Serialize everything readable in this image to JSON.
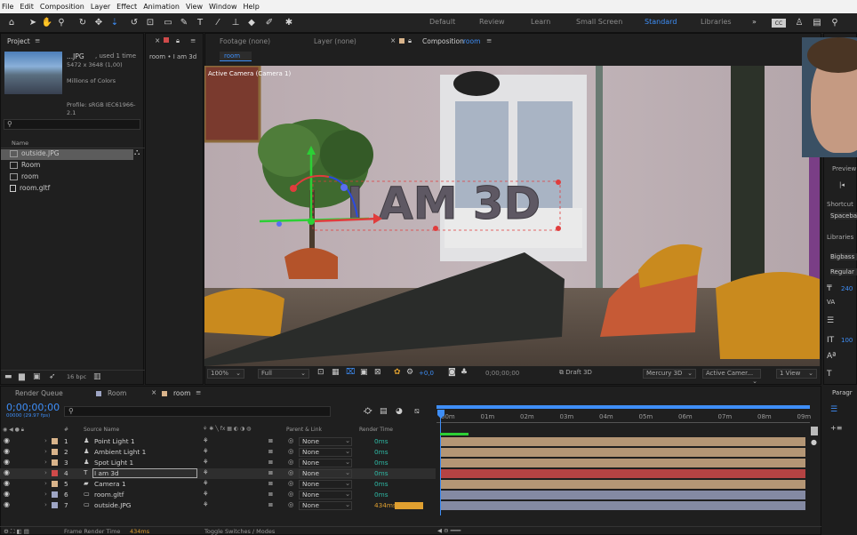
{
  "menu": [
    "File",
    "Edit",
    "Composition",
    "Layer",
    "Effect",
    "Animation",
    "View",
    "Window",
    "Help"
  ],
  "workspaces": {
    "items": [
      "Default",
      "Review",
      "Learn",
      "Small Screen",
      "Standard",
      "Libraries"
    ],
    "active": "Standard",
    "more": "»"
  },
  "project": {
    "title": "Project",
    "thumb_name": "...JPG",
    "thumb_used": ", used 1 time",
    "thumb_dims": "5472 x 3648 (1,00)",
    "thumb_colors": "Millions of Colors",
    "thumb_profile": "Profile: sRGB IEC61966-2.1",
    "search_placeholder": "",
    "col_name": "Name",
    "items": [
      "outside.JPG",
      "Room",
      "room",
      "room.gltf"
    ],
    "bpc": "16 bpc"
  },
  "layer_panel": {
    "tab": "room • I am 3d"
  },
  "viewer_tabs": {
    "footage": "Footage (none)",
    "layer": "Layer (none)",
    "composition": "Composition",
    "comp_name": "room",
    "sub_tab": "room"
  },
  "viewer": {
    "camera_label": "Active Camera (Camera 1)",
    "text_3d": "I AM 3D",
    "zoom": "100%",
    "quality": "Full",
    "exposure": "+0,0",
    "timecode": "0;00;00;00",
    "draft": "Draft 3D",
    "renderer": "Mercury 3D",
    "camera": "Active Camer...",
    "view": "1 View"
  },
  "timeline": {
    "tabs": [
      "Render Queue",
      "Room",
      "room"
    ],
    "active_tab": "room",
    "timecode": "0;00;00;00",
    "timecode_sub": "00000 (29.97 fps)",
    "col_hash": "#",
    "col_source": "Source Name",
    "col_parent": "Parent & Link",
    "col_render": "Render Time",
    "ruler": [
      "00m",
      "01m",
      "02m",
      "03m",
      "04m",
      "05m",
      "06m",
      "07m",
      "08m",
      "09m"
    ],
    "layers": [
      {
        "num": "1",
        "name": "Point Light 1",
        "parent": "None",
        "render": "0ms",
        "color": "#d9b48b"
      },
      {
        "num": "2",
        "name": "Ambient Light 1",
        "parent": "None",
        "render": "0ms",
        "color": "#d9b48b"
      },
      {
        "num": "3",
        "name": "Spot Light 1",
        "parent": "None",
        "render": "0ms",
        "color": "#d9b48b"
      },
      {
        "num": "4",
        "name": "I am 3d",
        "parent": "None",
        "render": "0ms",
        "color": "#d04a4a"
      },
      {
        "num": "5",
        "name": "Camera 1",
        "parent": "None",
        "render": "0ms",
        "color": "#d9b48b"
      },
      {
        "num": "6",
        "name": "room.gltf",
        "parent": "None",
        "render": "0ms",
        "color": "#9ea5c4"
      },
      {
        "num": "7",
        "name": "outside.JPG",
        "parent": "None",
        "render": "434ms",
        "color": "#9ea5c4"
      }
    ],
    "footer_left": "Frame Render Time",
    "footer_value": "434ms",
    "footer_mid": "Toggle Switches / Modes"
  },
  "right_panel": {
    "preview": "Preview",
    "shortcut": "Shortcut",
    "shortcut_value": "Spacebar",
    "libraries": "Libraries",
    "font": "Bigbass",
    "style": "Regular",
    "size": "240",
    "leading": "100",
    "paragraph": "Paragr"
  }
}
